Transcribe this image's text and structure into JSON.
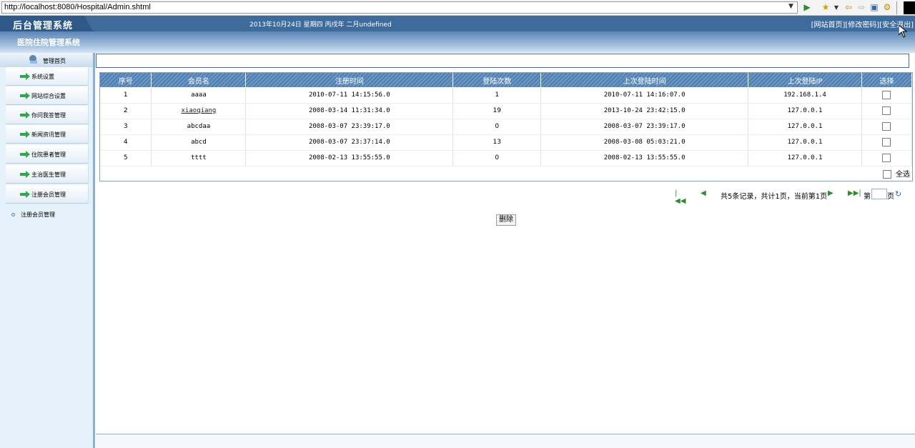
{
  "browser": {
    "url": "http://localhost:8080/Hospital/Admin.shtml"
  },
  "header": {
    "logo": "后台管理系统",
    "date": "2013年10月24日 星期四 丙戌年 二月undefined",
    "links": [
      "[网站首页]",
      "[修改密码]",
      "[安全退出]"
    ],
    "system_title": "医院住院管理系统"
  },
  "sidebar": {
    "home": "管理首页",
    "items": [
      "系统设置",
      "网站综合设置",
      "你问我答管理",
      "新闻资讯管理",
      "住院患者管理",
      "主治医生管理",
      "注册会员管理"
    ],
    "sub_item": "注册会员管理"
  },
  "table": {
    "headers": [
      "序号",
      "会员名",
      "注册时间",
      "登陆次数",
      "上次登陆时间",
      "上次登陆IP",
      "选择"
    ],
    "rows": [
      [
        "1",
        "aaaa",
        "2010-07-11 14:15:56.0",
        "1",
        "2010-07-11 14:16:07.0",
        "192.168.1.4"
      ],
      [
        "2",
        "xiaoqiang",
        "2008-03-14 11:31:34.0",
        "19",
        "2013-10-24 23:42:15.0",
        "127.0.0.1"
      ],
      [
        "3",
        "abcdaa",
        "2008-03-07 23:39:17.0",
        "0",
        "2008-03-07 23:39:17.0",
        "127.0.0.1"
      ],
      [
        "4",
        "abcd",
        "2008-03-07 23:37:14.0",
        "13",
        "2008-03-08 05:03:21.0",
        "127.0.0.1"
      ],
      [
        "5",
        "tttt",
        "2008-02-13 13:55:55.0",
        "0",
        "2008-02-13 13:55:55.0",
        "127.0.0.1"
      ]
    ],
    "select_all": "全选"
  },
  "pager": {
    "info": "共5条记录，共计1页，当前第1页",
    "di": "第",
    "ye": "页"
  },
  "actions": {
    "delete": "删除"
  },
  "colors": {
    "header_blue": "#3d6b9c",
    "grid_header": "#5b86b6",
    "sidebar_bg": "#e6f2fa"
  }
}
